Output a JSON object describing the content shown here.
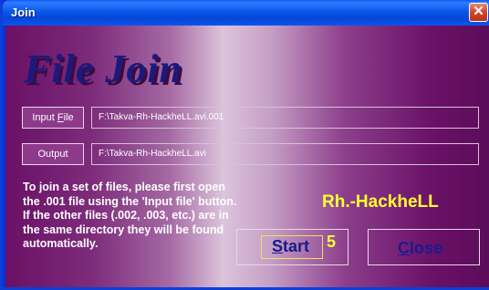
{
  "window": {
    "title": "Join",
    "close_glyph": "✕"
  },
  "main": {
    "heading": "File Join",
    "input_button": {
      "label_prefix": "Input ",
      "label_accel": "F",
      "label_suffix": "ile"
    },
    "input_path": "F:\\Takva-Rh-HackheLL.avi.001",
    "output_button": {
      "label": "Output"
    },
    "output_path": "F:\\Takva-Rh-HackheLL.avi",
    "instructions": "To join a set of files, please first open the .001 file using the 'Input file' button. If the other files (.002, .003, etc.) are in the same directory they will be found automatically.",
    "brand": "Rh.-HackheLL",
    "start_button": {
      "accel": "S",
      "rest": "tart"
    },
    "counter": "5",
    "close_button": {
      "accel": "C",
      "rest": "lose"
    }
  },
  "colors": {
    "titlebar": "#0a58e8",
    "heading": "#1a1a7e",
    "brand": "#ffff33",
    "button_text": "#1a1a8e"
  }
}
